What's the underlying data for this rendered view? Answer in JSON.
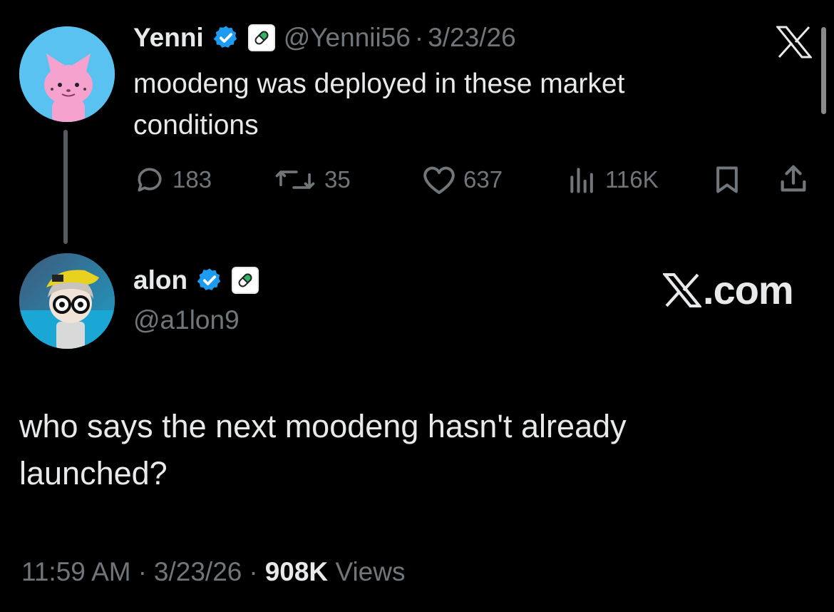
{
  "quoted_tweet": {
    "author_name": "Yenni",
    "handle": "@Yennii56",
    "separator": "·",
    "date": "3/23/26",
    "text_line1": "moodeng was deployed in these market",
    "text_line2": "conditions",
    "replies": "183",
    "reposts": "35",
    "likes": "637",
    "views": "116K"
  },
  "main_tweet": {
    "author_name": "alon",
    "handle": "@a1lon9",
    "source_label": "com",
    "text_line1": "who says the next moodeng hasn't already",
    "text_line2": "launched?"
  },
  "footer": {
    "time": "11:59 AM",
    "sep1": "·",
    "date": "3/23/26",
    "sep2": "·",
    "views_count": "908K",
    "views_label": "Views"
  },
  "colors": {
    "background": "#000000",
    "text": "#e7e9ea",
    "muted": "#71767b",
    "verified_blue": "#1d9bf0",
    "pill_green": "#2fb565"
  },
  "icons": [
    "verified-badge-icon",
    "pill-icon",
    "x-logo-icon",
    "reply-icon",
    "repost-icon",
    "like-icon",
    "views-icon",
    "bookmark-icon",
    "share-icon"
  ]
}
